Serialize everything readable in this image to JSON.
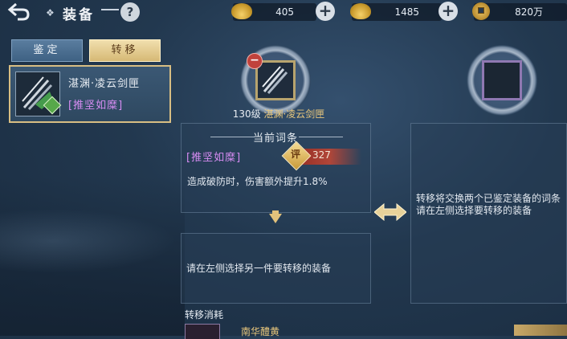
{
  "header": {
    "title": "装备",
    "back_icon": "back-arrow-icon",
    "help_label": "?"
  },
  "resources": [
    {
      "icon": "gold-ingot-icon",
      "value": "405"
    },
    {
      "icon": "gold-ingot-icon",
      "value": "1485"
    },
    {
      "icon": "copper-coin-icon",
      "value": "820万"
    }
  ],
  "tabs": [
    {
      "label": "鉴定",
      "active": false
    },
    {
      "label": "转移",
      "active": true
    }
  ],
  "item_list": [
    {
      "name": "湛渊·凌云剑匣",
      "attribute": "[推坚如糜]"
    }
  ],
  "slots": {
    "left_label_level": "130级",
    "left_label_name": "湛渊·凌云剑匣",
    "remove_label": "−"
  },
  "current_entry": {
    "title": "当前词条",
    "attribute": "[推坚如糜]",
    "score_badge": "评",
    "score": "327",
    "effect": "造成破防时，伤害额外提升1.8%"
  },
  "target_entry": {
    "prompt": "请在左侧选择另一件要转移的装备"
  },
  "description": {
    "line1": "转移将交换两个已鉴定装备的词条",
    "line2": "请在左侧选择要转移的装备"
  },
  "cost": {
    "title": "转移消耗",
    "item_name": "南华醴黄"
  },
  "colors": {
    "accent_gold": "#e8c77c",
    "attribute_purple": "#d68cf2",
    "tab_active": "#e8d29a"
  }
}
